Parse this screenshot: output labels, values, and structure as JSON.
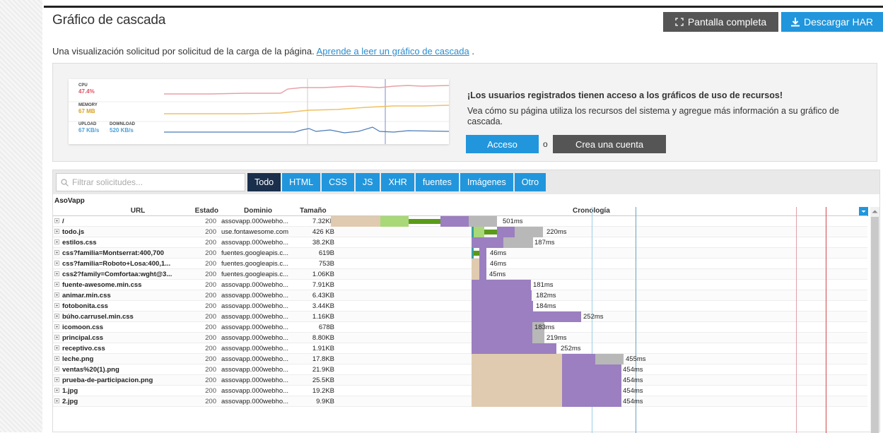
{
  "header": {
    "title": "Gráfico de cascada",
    "fullscreen_label": "Pantalla completa",
    "download_label": "Descargar HAR"
  },
  "subtitle": {
    "text": "Una visualización solicitud por solicitud de la carga de la página.",
    "link": "Aprende a leer un gráfico de cascada",
    "suffix": "."
  },
  "promo": {
    "heading": "¡Los usuarios registrados tienen acceso a los gráficos de uso de recursos!",
    "text": "Vea cómo su página utiliza los recursos del sistema y agregue más información a su gráfico de cascada.",
    "login_label": "Acceso",
    "or_label": "o",
    "create_label": "Crea una cuenta",
    "chart": {
      "cpu_label": "CPU",
      "cpu_value": "47.4%",
      "memory_label": "MEMORY",
      "memory_value": "67 MB",
      "upload_label": "UPLOAD",
      "upload_value": "67 KB/s",
      "download_label": "DOWNLOAD",
      "download_value": "520 KB/s",
      "colors": {
        "cpu": "#e8a0a8",
        "memory": "#f0c060",
        "network": "#4a7ab8"
      }
    }
  },
  "waterfall": {
    "filter_placeholder": "Filtrar solicitudes...",
    "tabs": [
      {
        "label": "Todo",
        "active": true
      },
      {
        "label": "HTML"
      },
      {
        "label": "CSS"
      },
      {
        "label": "JS"
      },
      {
        "label": "XHR"
      },
      {
        "label": "fuentes"
      },
      {
        "label": "Imágenes"
      },
      {
        "label": "Otro"
      }
    ],
    "app_name": "AsoVapp",
    "columns": {
      "url": "URL",
      "status": "Estado",
      "domain": "Dominio",
      "size": "Tamaño",
      "timeline": "Cronología"
    },
    "colors": {
      "blocked": "#e0cbb0",
      "dns": "#a8d878",
      "connect": "#5a9a18",
      "wait": "#9b7fc0",
      "receive": "#b8b8b8",
      "ssl": "#3aa0a0"
    },
    "rows": [
      {
        "url": "/",
        "status": "200",
        "domain": "assovapp.000webho...",
        "size": "7.32KB",
        "time": "501ms"
      },
      {
        "url": "todo.js",
        "status": "200",
        "domain": "use.fontawesome.com",
        "size": "426 KB",
        "time": "220ms"
      },
      {
        "url": "estilos.css",
        "status": "200",
        "domain": "assovapp.000webho...",
        "size": "38.2KB",
        "time": "187ms"
      },
      {
        "url": "css?familia=Montserrat:400,700",
        "status": "200",
        "domain": "fuentes.googleapis.c...",
        "size": "619B",
        "time": "46ms"
      },
      {
        "url": "css?familia=Roboto+Losa:400,1...",
        "status": "200",
        "domain": "fuentes.googleapis.c...",
        "size": "753B",
        "time": "46ms"
      },
      {
        "url": "css2?family=Comfortaa:wght@3...",
        "status": "200",
        "domain": "fuentes.googleapis.c...",
        "size": "1.06KB",
        "time": "45ms"
      },
      {
        "url": "fuente-awesome.min.css",
        "status": "200",
        "domain": "assovapp.000webho...",
        "size": "7.91KB",
        "time": "181ms"
      },
      {
        "url": "animar.min.css",
        "status": "200",
        "domain": "assovapp.000webho...",
        "size": "6.43KB",
        "time": "182ms"
      },
      {
        "url": "fotobonita.css",
        "status": "200",
        "domain": "assovapp.000webho...",
        "size": "3.44KB",
        "time": "184ms"
      },
      {
        "url": "búho.carrusel.min.css",
        "status": "200",
        "domain": "assovapp.000webho...",
        "size": "1.16KB",
        "time": "252ms"
      },
      {
        "url": "icomoon.css",
        "status": "200",
        "domain": "assovapp.000webho...",
        "size": "678B",
        "time": "183ms"
      },
      {
        "url": "principal.css",
        "status": "200",
        "domain": "assovapp.000webho...",
        "size": "8.80KB",
        "time": "219ms"
      },
      {
        "url": "receptivo.css",
        "status": "200",
        "domain": "assovapp.000webho...",
        "size": "1.91KB",
        "time": "252ms"
      },
      {
        "url": "leche.png",
        "status": "200",
        "domain": "assovapp.000webho...",
        "size": "17.8KB",
        "time": "455ms"
      },
      {
        "url": "ventas%20(1).png",
        "status": "200",
        "domain": "assovapp.000webho...",
        "size": "21.9KB",
        "time": "454ms"
      },
      {
        "url": "prueba-de-participacion.png",
        "status": "200",
        "domain": "assovapp.000webho...",
        "size": "25.5KB",
        "time": "454ms"
      },
      {
        "url": "1.jpg",
        "status": "200",
        "domain": "assovapp.000webho...",
        "size": "19.2KB",
        "time": "454ms"
      },
      {
        "url": "2.jpg",
        "status": "200",
        "domain": "assovapp.000webho...",
        "size": "9.9KB",
        "time": "454ms"
      }
    ]
  }
}
